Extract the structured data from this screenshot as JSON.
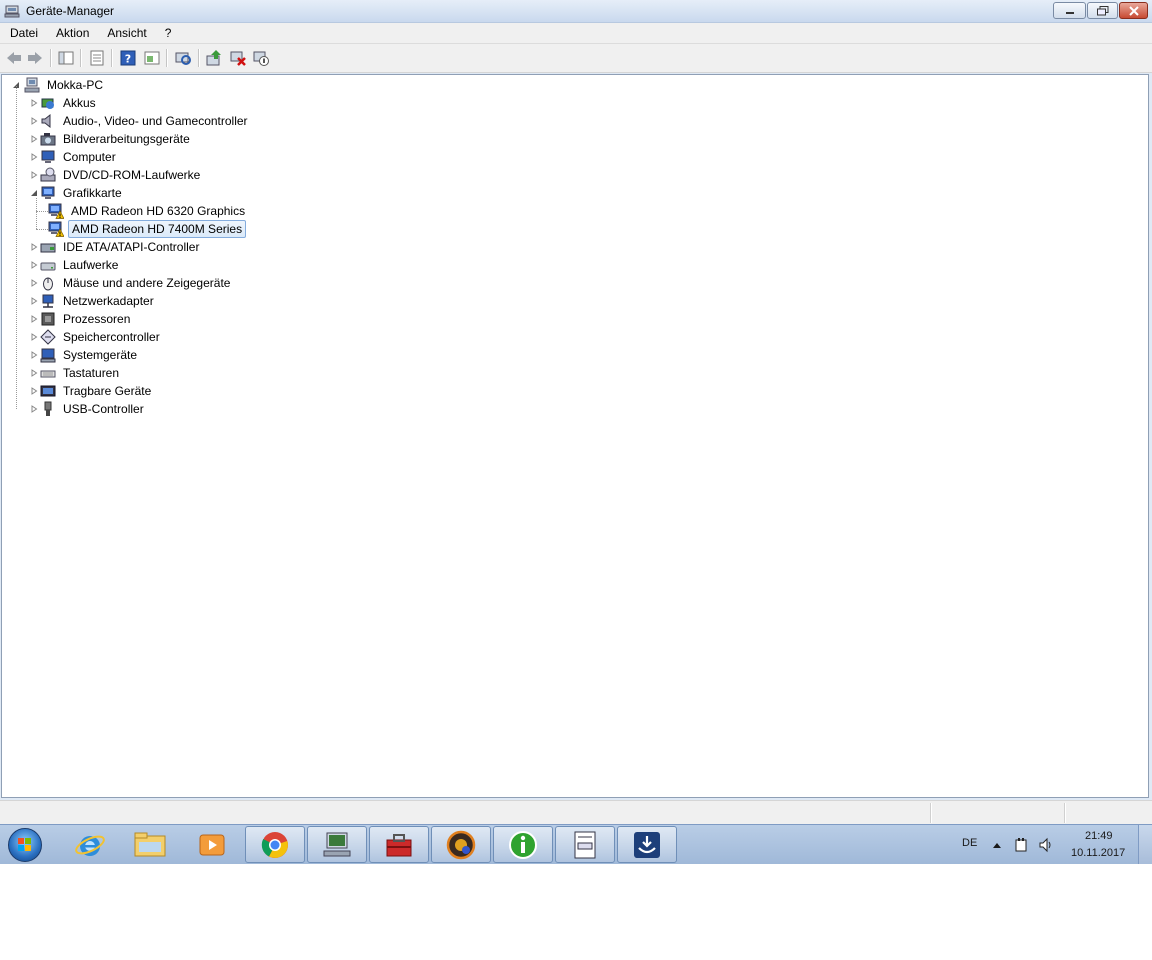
{
  "window": {
    "title": "Geräte-Manager"
  },
  "menubar": {
    "items": [
      "Datei",
      "Aktion",
      "Ansicht",
      "?"
    ]
  },
  "toolbar": {
    "buttons": [
      "back-arrow-icon",
      "forward-arrow-icon",
      "show-hide-console-tree-icon",
      "properties-list-icon",
      "help-icon",
      "view-icon",
      "scan-hardware-icon",
      "update-driver-icon",
      "uninstall-icon",
      "disable-device-icon"
    ]
  },
  "tree": {
    "root": "Mokka-PC",
    "categories": [
      {
        "label": "Akkus",
        "icon": "battery-icon",
        "expanded": false
      },
      {
        "label": "Audio-, Video- und Gamecontroller",
        "icon": "speaker-icon",
        "expanded": false
      },
      {
        "label": "Bildverarbeitungsgeräte",
        "icon": "camera-icon",
        "expanded": false
      },
      {
        "label": "Computer",
        "icon": "computer-icon",
        "expanded": false
      },
      {
        "label": "DVD/CD-ROM-Laufwerke",
        "icon": "dvd-drive-icon",
        "expanded": false
      },
      {
        "label": "Grafikkarte",
        "icon": "display-adapter-icon",
        "expanded": true,
        "children": [
          {
            "label": "AMD Radeon HD 6320 Graphics",
            "warning": true,
            "selected": false
          },
          {
            "label": "AMD Radeon HD 7400M Series",
            "warning": true,
            "selected": true
          }
        ]
      },
      {
        "label": "IDE ATA/ATAPI-Controller",
        "icon": "ide-controller-icon",
        "expanded": false
      },
      {
        "label": "Laufwerke",
        "icon": "disk-drive-icon",
        "expanded": false
      },
      {
        "label": "Mäuse und andere Zeigegeräte",
        "icon": "mouse-icon",
        "expanded": false
      },
      {
        "label": "Netzwerkadapter",
        "icon": "network-adapter-icon",
        "expanded": false
      },
      {
        "label": "Prozessoren",
        "icon": "processor-icon",
        "expanded": false
      },
      {
        "label": "Speichercontroller",
        "icon": "storage-controller-icon",
        "expanded": false
      },
      {
        "label": "Systemgeräte",
        "icon": "system-devices-icon",
        "expanded": false
      },
      {
        "label": "Tastaturen",
        "icon": "keyboard-icon",
        "expanded": false
      },
      {
        "label": "Tragbare Geräte",
        "icon": "portable-devices-icon",
        "expanded": false
      },
      {
        "label": "USB-Controller",
        "icon": "usb-icon",
        "expanded": false
      }
    ]
  },
  "taskbar": {
    "pinned": [
      "internet-explorer-icon",
      "windows-explorer-icon",
      "media-player-icon",
      "chrome-icon",
      "device-manager-icon",
      "toolbox-icon",
      "gaming-app-icon",
      "info-icon",
      "notepad-document-icon",
      "download-app-icon"
    ],
    "language": "DE",
    "time": "21:49",
    "date": "10.11.2017"
  },
  "colors": {
    "selection_border": "#84acdd",
    "taskbar": "#a9c1de",
    "warning": "#f2c200"
  }
}
